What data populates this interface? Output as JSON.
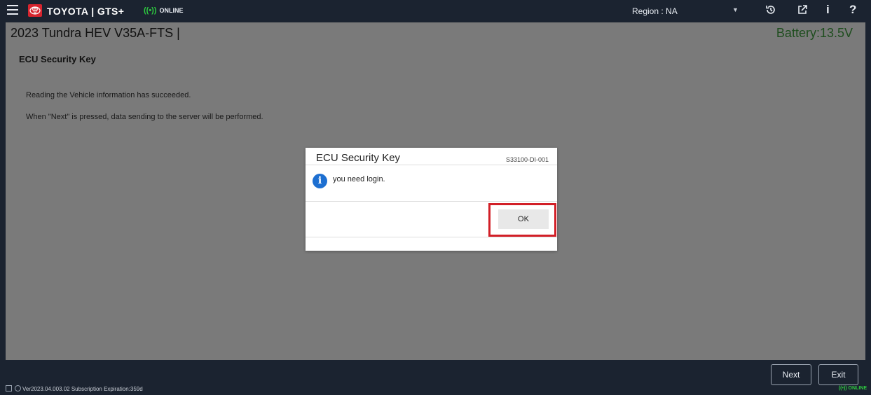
{
  "topbar": {
    "brand": "TOYOTA | GTS+",
    "online_signal": "((•))",
    "online_label": "ONLINE",
    "region": "Region : NA",
    "icons": [
      "menu-icon",
      "toyota-logo-icon",
      "history-icon",
      "external-link-icon",
      "info-icon",
      "help-icon"
    ]
  },
  "vehicle": {
    "title": "2023 Tundra HEV V35A-FTS  |",
    "battery": "Battery:13.5V"
  },
  "screen": {
    "title": "ECU Security Key",
    "message1": "Reading the Vehicle information has succeeded.",
    "message2": "When \"Next\" is pressed, data sending to the server will be performed."
  },
  "dialog": {
    "title": "ECU Security Key",
    "code": "S33100-DI-001",
    "message": "you need login.",
    "ok_label": "OK"
  },
  "bottombar": {
    "next_label": "Next",
    "exit_label": "Exit"
  },
  "statusbar": {
    "version": "Ver2023.04.003.02  Subscription Expiration:359d",
    "online_label": "((•)) ONLINE"
  },
  "colors": {
    "bar": "#1b2330",
    "content": "#7a7a7a",
    "brand_red": "#d7242e",
    "highlight": "#d21f27",
    "online_green": "#2ecc40",
    "battery_green": "#1f4e1f",
    "info_blue": "#1d6fd1"
  }
}
